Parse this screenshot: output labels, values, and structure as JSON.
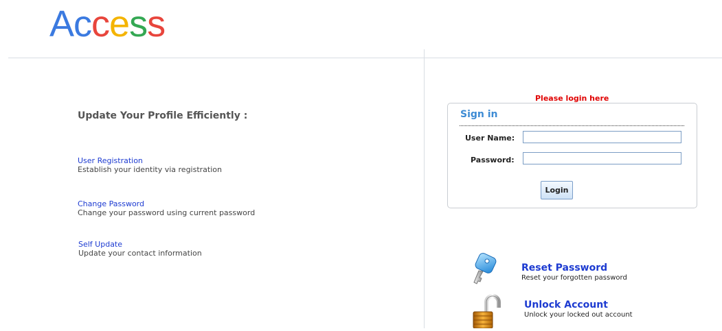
{
  "logo": {
    "letters": [
      "A",
      "c",
      "c",
      "e",
      "s",
      "s"
    ],
    "colors": [
      "#3b7ae0",
      "#3b7ae0",
      "#e8453c",
      "#f4b400",
      "#34a853",
      "#e8453c"
    ]
  },
  "left": {
    "heading": "Update Your Profile Efficiently :",
    "features": [
      {
        "link": "User Registration",
        "desc": "Establish your identity via registration"
      },
      {
        "link": "Change Password",
        "desc": "Change your password using current password"
      },
      {
        "link": "Self Update",
        "desc": "Update your contact information"
      }
    ]
  },
  "login": {
    "prompt": "Please login here",
    "title": "Sign in",
    "username_label": "User Name:",
    "username_value": "",
    "password_label": "Password:",
    "password_value": "",
    "button_label": "Login"
  },
  "actions": [
    {
      "title": "Reset Password",
      "desc": "Reset your forgotten password",
      "icon": "key-icon"
    },
    {
      "title": "Unlock Account",
      "desc": "Unlock your locked out account",
      "icon": "padlock-icon"
    }
  ],
  "colors": {
    "link": "#1d3bd1",
    "prompt": "#e00000",
    "signin_title": "#3d8bd4"
  }
}
